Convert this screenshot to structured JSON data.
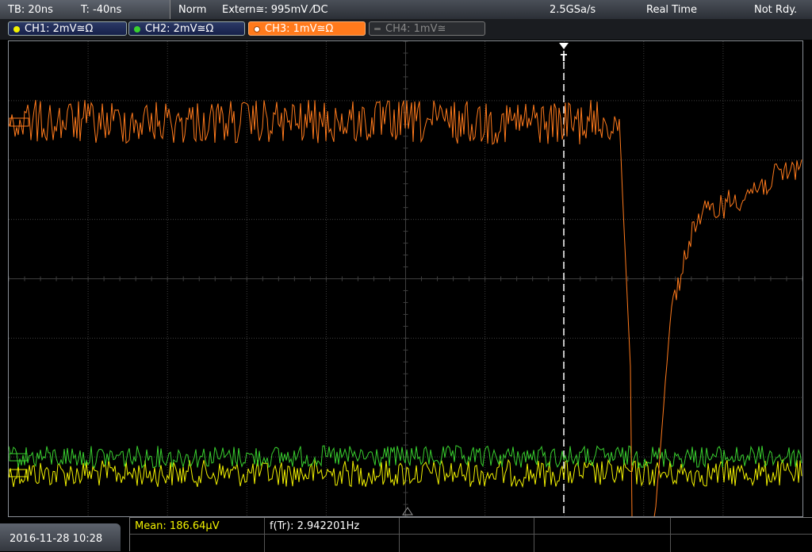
{
  "status_bar": {
    "timebase": "TB: 20ns",
    "trigger_time": "T: -40ns",
    "mode": "Norm",
    "trigger_source": "Extern≅: 995mV ⁄DC",
    "sample_rate": "2.5GSa/s",
    "acq_mode": "Real Time",
    "state": "Not Rdy."
  },
  "channels": [
    {
      "label": "CH1: 2mV≅Ω",
      "color": "#f2f200",
      "active": true
    },
    {
      "label": "CH2: 2mV≅Ω",
      "color": "#39d12f",
      "active": true
    },
    {
      "label": "CH3: 1mV≅Ω",
      "color": "#ff7a1c",
      "active": true
    },
    {
      "label": "CH4: 1mV≅",
      "color": "#777777",
      "active": false
    }
  ],
  "footer": {
    "datetime": "2016-11-28 10:28",
    "mean_label": "Mean: 186.64µV",
    "freq_label": "f(Tr): 2.942201Hz"
  },
  "colors": {
    "grid": "#3f3f3f",
    "ch1": "#f2f200",
    "ch2": "#39d12f",
    "ch3": "#ff7a1c"
  },
  "icons": {
    "trigger_marker": "trigger-t-icon",
    "ground_marker": "ground-marker-icon"
  }
}
